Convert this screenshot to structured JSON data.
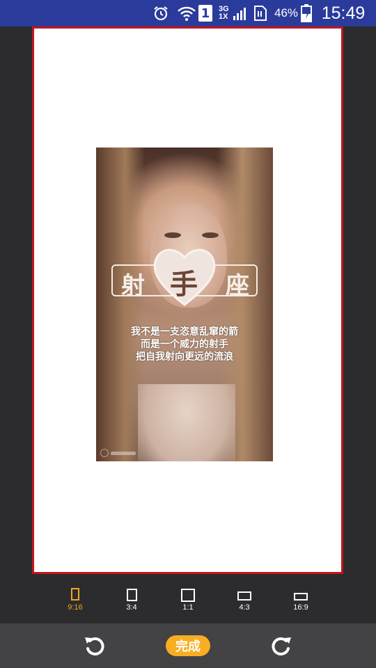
{
  "status_bar": {
    "alarm_icon": "alarm-clock-icon",
    "wifi_icon": "wifi-icon",
    "sim_slot": "1",
    "network_top": "3G",
    "network_bottom": "1X",
    "signal_icon": "signal-bars-icon",
    "data_icon": "sim-data-icon",
    "battery_percent": "46%",
    "battery_icon": "battery-charging-icon",
    "time": "15:49"
  },
  "canvas": {
    "border_color": "#c0161c",
    "background": "#ffffff",
    "image": {
      "badge_left": "射",
      "badge_center": "手",
      "badge_right": "座",
      "poem": [
        "我不是一支恣意乱窜的箭",
        "而是一个威力的射手",
        "把自我射向更远的流浪"
      ],
      "watermark_icon": "watermark-logo-icon"
    }
  },
  "aspect_ratios": {
    "active_color": "#f5a623",
    "selected": "9:16",
    "options": [
      "9:16",
      "3:4",
      "1:1",
      "4:3",
      "16:9"
    ]
  },
  "toolbar": {
    "rotate_left_icon": "rotate-counterclockwise-icon",
    "done_label": "完成",
    "rotate_right_icon": "rotate-clockwise-icon",
    "accent": "#f8ad22"
  }
}
